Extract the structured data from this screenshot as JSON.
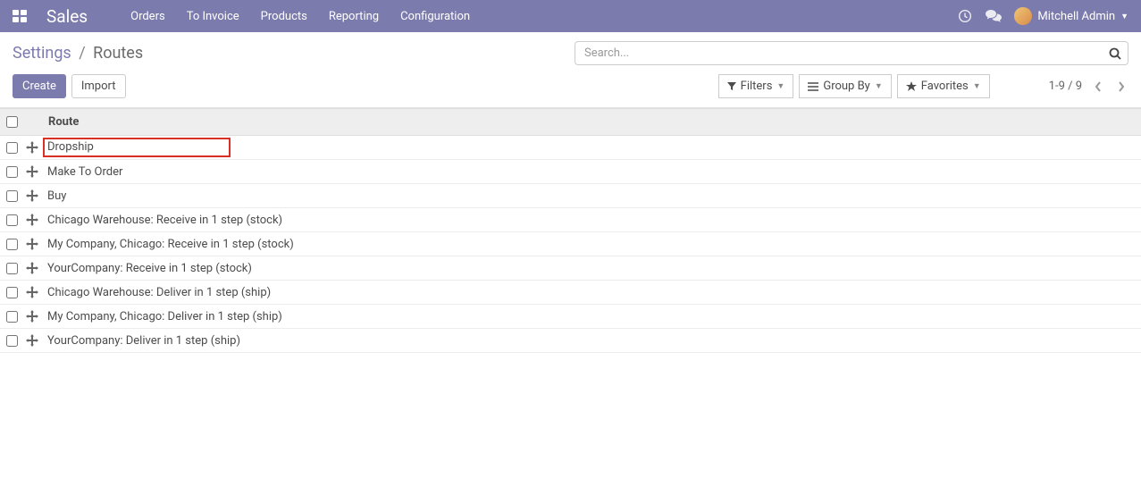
{
  "navbar": {
    "brand": "Sales",
    "menu": [
      "Orders",
      "To Invoice",
      "Products",
      "Reporting",
      "Configuration"
    ],
    "user": "Mitchell Admin"
  },
  "breadcrumb": {
    "parent": "Settings",
    "sep": "/",
    "current": "Routes"
  },
  "search": {
    "placeholder": "Search..."
  },
  "buttons": {
    "create": "Create",
    "import": "Import",
    "filters": "Filters",
    "groupby": "Group By",
    "favorites": "Favorites"
  },
  "pager": {
    "range": "1-9 / 9"
  },
  "table": {
    "header": "Route",
    "rows": [
      {
        "label": "Dropship",
        "highlighted": true
      },
      {
        "label": "Make To Order",
        "highlighted": false
      },
      {
        "label": "Buy",
        "highlighted": false
      },
      {
        "label": "Chicago Warehouse: Receive in 1 step (stock)",
        "highlighted": false
      },
      {
        "label": "My Company, Chicago: Receive in 1 step (stock)",
        "highlighted": false
      },
      {
        "label": "YourCompany: Receive in 1 step (stock)",
        "highlighted": false
      },
      {
        "label": "Chicago Warehouse: Deliver in 1 step (ship)",
        "highlighted": false
      },
      {
        "label": "My Company, Chicago: Deliver in 1 step (ship)",
        "highlighted": false
      },
      {
        "label": "YourCompany: Deliver in 1 step (ship)",
        "highlighted": false
      }
    ]
  }
}
